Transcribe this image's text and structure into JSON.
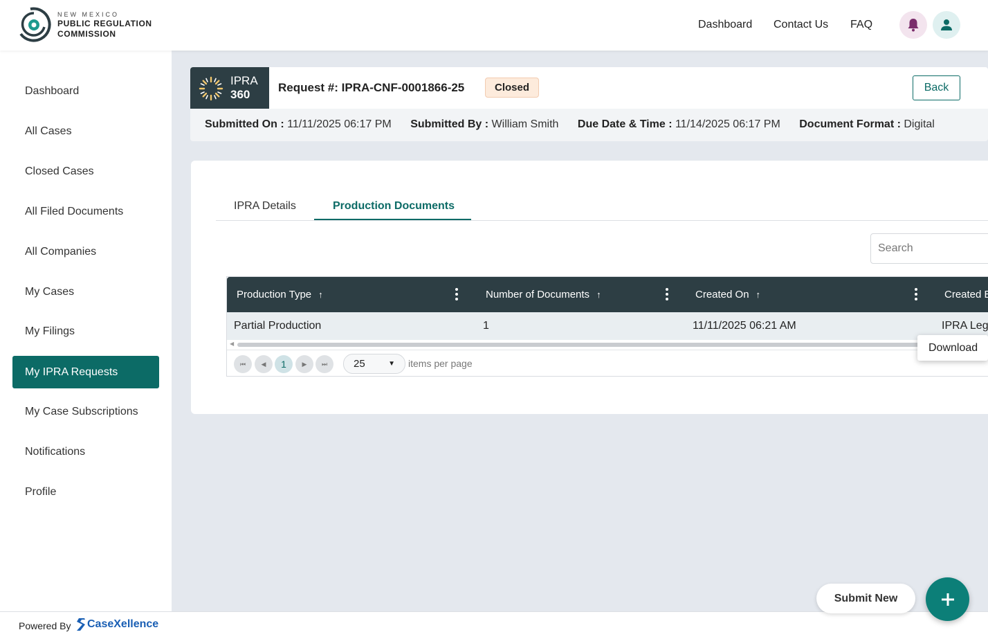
{
  "brand": {
    "sub": "NEW MEXICO",
    "line1": "PUBLIC REGULATION",
    "line2": "COMMISSION"
  },
  "topnav": {
    "dashboard": "Dashboard",
    "contact": "Contact Us",
    "faq": "FAQ"
  },
  "sidebar": {
    "items": [
      {
        "label": "Dashboard"
      },
      {
        "label": "All Cases"
      },
      {
        "label": "Closed Cases"
      },
      {
        "label": "All Filed Documents"
      },
      {
        "label": "All Companies"
      },
      {
        "label": "My Cases"
      },
      {
        "label": "My Filings"
      },
      {
        "label": "My IPRA Requests"
      },
      {
        "label": "My Case Subscriptions"
      },
      {
        "label": "Notifications"
      },
      {
        "label": "Profile"
      }
    ]
  },
  "request": {
    "badge_line1": "IPRA",
    "badge_line2": "360",
    "title": "Request #: IPRA-CNF-0001866-25",
    "status": "Closed",
    "back_label": "Back",
    "meta": {
      "submitted_on_key": "Submitted On :",
      "submitted_on": "11/11/2025 06:17 PM",
      "submitted_by_key": "Submitted By :",
      "submitted_by": "William Smith",
      "due_key": "Due Date & Time :",
      "due": "11/14/2025 06:17 PM",
      "format_key": "Document Format :",
      "format": "Digital"
    }
  },
  "tabs": {
    "details": "IPRA Details",
    "production": "Production Documents"
  },
  "search": {
    "placeholder": "Search"
  },
  "grid": {
    "columns": [
      "Production Type",
      "Number of Documents",
      "Created On",
      "Created B"
    ],
    "rows": [
      [
        "Partial Production",
        "1",
        "11/11/2025 06:21 AM",
        "IPRA Leg"
      ]
    ],
    "current_page": "1",
    "page_size": "25",
    "per_page_label": "items per page"
  },
  "context_menu": {
    "download": "Download"
  },
  "footer": {
    "powered_by": "Powered By",
    "brand_name": "CaseXellence"
  },
  "fab": {
    "label": "Submit New"
  },
  "colors": {
    "accent": "#0c6b66",
    "header_dark": "#2d3e44",
    "status_bg": "#fdebdc"
  }
}
